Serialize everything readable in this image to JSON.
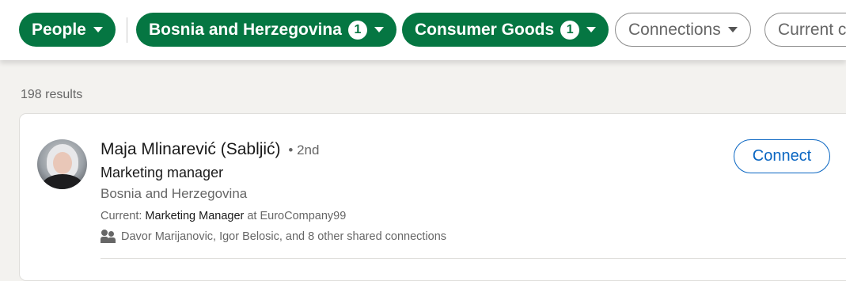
{
  "filters": [
    {
      "label": "People",
      "count": null,
      "active": true
    },
    {
      "label": "Bosnia and Herzegovina",
      "count": "1",
      "active": true
    },
    {
      "label": "Consumer Goods",
      "count": "1",
      "active": true
    },
    {
      "label": "Connections",
      "count": null,
      "active": false
    },
    {
      "label": "Current c",
      "count": null,
      "active": false
    }
  ],
  "results": {
    "count_text": "198 results"
  },
  "profile": {
    "name": "Maja Mlinarević (Sabljić)",
    "degree": "• 2nd",
    "headline": "Marketing manager",
    "location": "Bosnia and Herzegovina",
    "current_prefix": "Current: ",
    "current_role": "Marketing Manager",
    "current_company": " at EuroCompany99",
    "shared_connections": "Davor Marijanovic, Igor Belosic, and 8 other shared connections",
    "connect_label": "Connect"
  },
  "colors": {
    "accent_green": "#057642",
    "link_blue": "#0a66c2"
  },
  "icons": {
    "caret": "caret-down-icon",
    "people": "people-icon"
  }
}
